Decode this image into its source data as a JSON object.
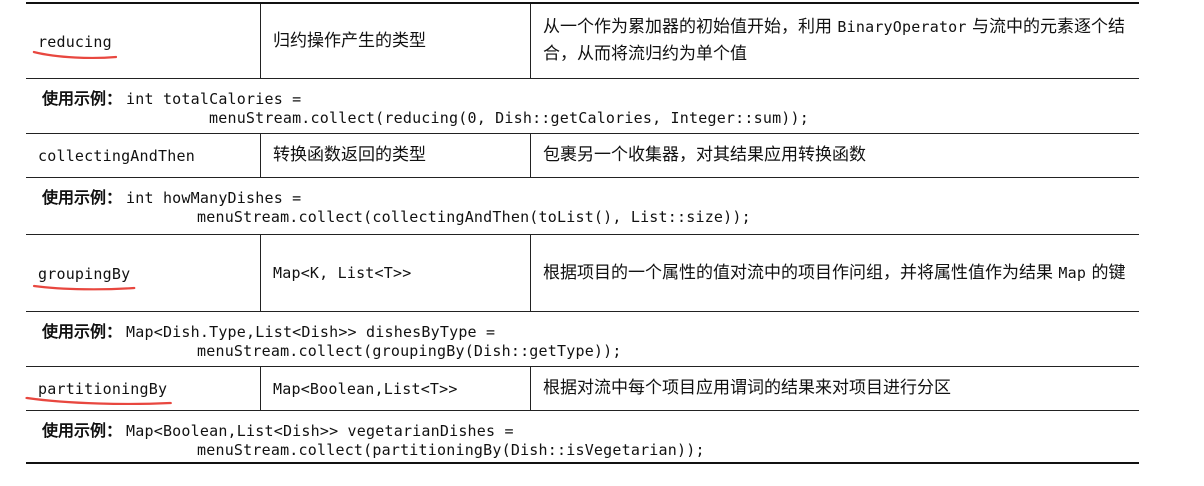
{
  "rows": [
    {
      "name": "reducing",
      "type": "归约操作产生的类型",
      "type_is_code": false,
      "desc": [
        "从一个作为累加器的初始值开始，利用 ",
        "BinaryOperator",
        " 与流中的元素逐个结合，从而将流归约为单个值"
      ],
      "underlined": true,
      "example_label": "使用示例：",
      "example_line1": "int totalCalories =",
      "example_line2": "menuStream.collect(reducing(0, Dish::getCalories, Integer::sum));"
    },
    {
      "name": "collectingAndThen",
      "type": "转换函数返回的类型",
      "type_is_code": false,
      "desc": [
        "包裹另一个收集器，对其结果应用转换函数",
        "",
        ""
      ],
      "underlined": false,
      "example_label": "使用示例：",
      "example_line1": "int howManyDishes =",
      "example_line2": "menuStream.collect(collectingAndThen(toList(), List::size));"
    },
    {
      "name": "groupingBy",
      "type": "Map<K, List<T>>",
      "type_is_code": true,
      "desc": [
        "根据项目的一个属性的值对流中的项目作问组，并将属性值作为结果 ",
        "Map",
        " 的键"
      ],
      "underlined": true,
      "example_label": "使用示例：",
      "example_line1": "Map<Dish.Type,List<Dish>> dishesByType =",
      "example_line2": "menuStream.collect(groupingBy(Dish::getType));"
    },
    {
      "name": "partitioningBy",
      "type": "Map<Boolean,List<T>>",
      "type_is_code": true,
      "desc": [
        "根据对流中每个项目应用谓词的结果来对项目进行分区",
        "",
        ""
      ],
      "underlined": true,
      "example_label": "使用示例：",
      "example_line1": "Map<Boolean,List<Dish>> vegetarianDishes =",
      "example_line2": "menuStream.collect(partitioningBy(Dish::isVegetarian));"
    }
  ],
  "colors": {
    "underline": "#e8473f",
    "border": "#222222"
  }
}
